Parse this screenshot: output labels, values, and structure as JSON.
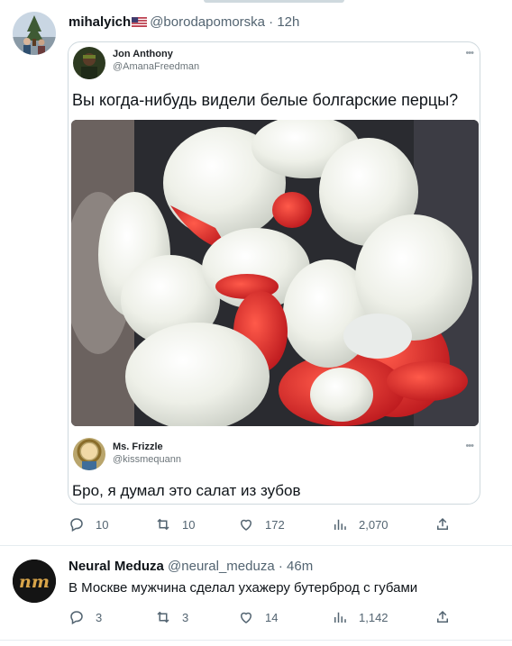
{
  "tweets": [
    {
      "author": {
        "name": "mihalyich",
        "flag": "us-flag-icon",
        "handle": "@borodapomorska",
        "time": "12h"
      },
      "quoted_image": {
        "top_post": {
          "name": "Jon Anthony",
          "handle": "@AmanaFreedman",
          "text": "Вы когда-нибудь видели белые болгарские перцы?"
        },
        "bottom_post": {
          "name": "Ms. Frizzle",
          "handle": "@kissmequann",
          "text": "Бро, я думал это салат из зубов"
        },
        "more": "•••"
      },
      "actions": {
        "replies": "10",
        "retweets": "10",
        "likes": "172",
        "views": "2,070"
      }
    },
    {
      "author": {
        "name": "Neural Meduza",
        "handle": "@neural_meduza",
        "time": "46m",
        "avatar_text": "nm"
      },
      "text": "В Москве мужчина сделал ухажеру бутерброд с губами",
      "actions": {
        "replies": "3",
        "retweets": "3",
        "likes": "14",
        "views": "1,142"
      }
    }
  ],
  "separator": "·",
  "colors": {
    "text": "#0f1419",
    "secondary": "#536471",
    "border": "#cfd9de",
    "pepper_red": "#e0302a"
  }
}
